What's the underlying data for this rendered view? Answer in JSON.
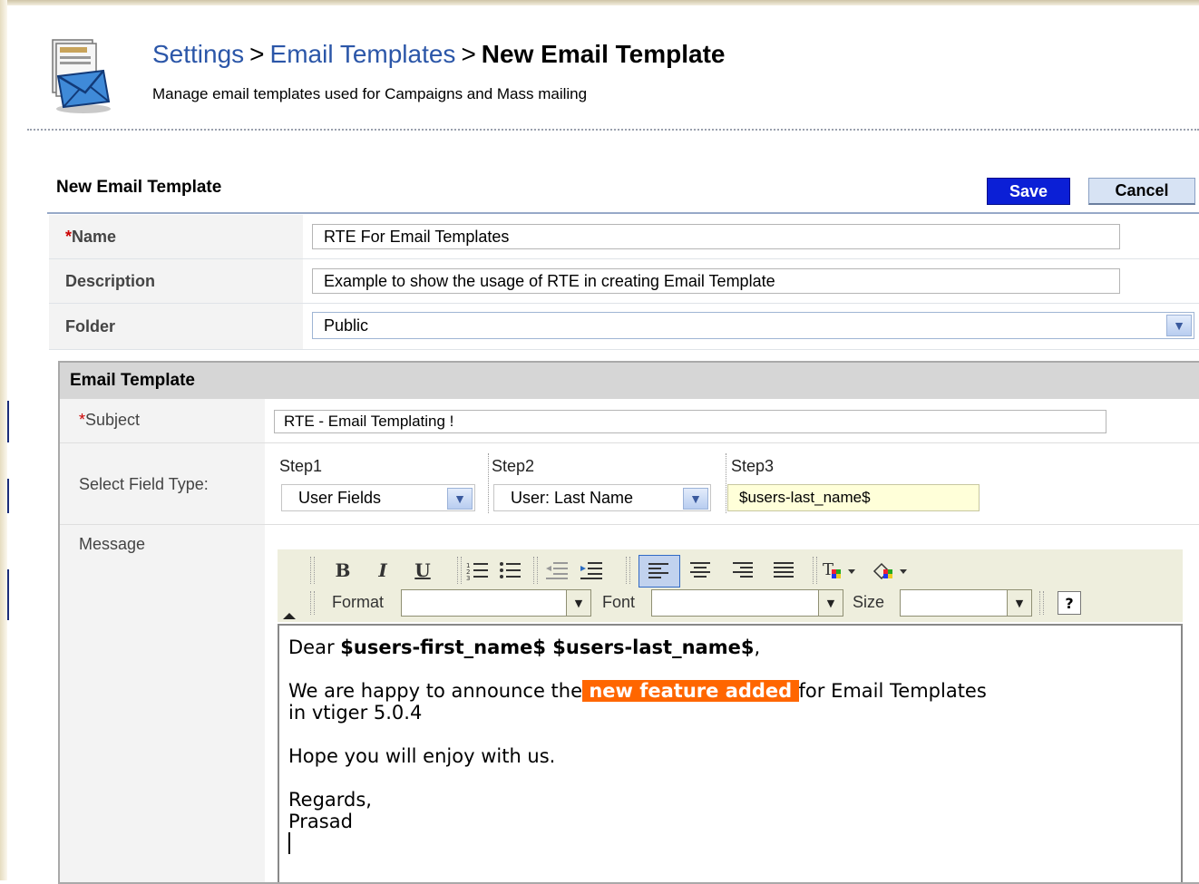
{
  "header": {
    "breadcrumb": {
      "settings": "Settings",
      "sep1": ">",
      "email_templates": "Email Templates",
      "sep2": ">",
      "current": "New Email Template"
    },
    "subtitle": "Manage email templates used for Campaigns and Mass mailing"
  },
  "form": {
    "section_title": "New Email Template",
    "save_label": "Save",
    "cancel_label": "Cancel",
    "name": {
      "required_mark": "*",
      "label": "Name",
      "value": "RTE For Email Templates"
    },
    "description": {
      "label": "Description",
      "value": "Example to show the usage of RTE in creating Email Template"
    },
    "folder": {
      "label": "Folder",
      "value": "Public"
    }
  },
  "email_template": {
    "title": "Email Template",
    "subject": {
      "required_mark": "*",
      "label": "Subject",
      "value": "RTE - Email Templating !"
    },
    "field_type": {
      "label": "Select Field Type:",
      "step1_label": "Step1",
      "step1_value": "User Fields",
      "step2_label": "Step2",
      "step2_value": "User: Last Name",
      "step3_label": "Step3",
      "step3_value": "$users-last_name$"
    },
    "message": {
      "label": "Message",
      "toolbar": {
        "format_label": "Format",
        "font_label": "Font",
        "size_label": "Size",
        "help": "?"
      },
      "body": {
        "greeting_prefix": "Dear ",
        "greeting_vars": "$users-first_name$ $users-last_name$",
        "greeting_suffix": ",",
        "line2_prefix": "We are happy to announce the",
        "line2_highlight": " new feature added ",
        "line2_suffix": "for Email Templates",
        "line3": "in vtiger 5.0.4",
        "line4": "Hope you will enjoy with us.",
        "line5": "Regards,",
        "line6": "Prasad"
      }
    }
  },
  "colors": {
    "link": "#2b56a8",
    "save_button": "#0b1fd6",
    "highlight": "#ff6600",
    "required": "#cc0000"
  }
}
